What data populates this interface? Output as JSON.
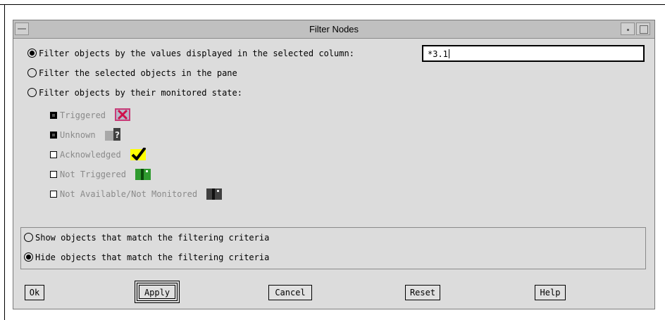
{
  "window": {
    "title": "Filter Nodes"
  },
  "filter_options": {
    "by_column_label": "Filter objects by the values displayed in the selected column:",
    "by_column_value": "*3.1",
    "selected_objects_label": "Filter the selected objects in the pane",
    "monitored_state_label": "Filter objects by their monitored state:",
    "selected": "by_column"
  },
  "states": [
    {
      "label": "Triggered",
      "checked": true,
      "icon": "triggered-x-icon",
      "color": "#c83c78"
    },
    {
      "label": "Unknown",
      "checked": true,
      "icon": "unknown-question-icon",
      "color": "#a0a0a0"
    },
    {
      "label": "Acknowledged",
      "checked": false,
      "icon": "acknowledged-check-icon",
      "color": "#ffff00"
    },
    {
      "label": "Not Triggered",
      "checked": false,
      "icon": "not-triggered-icon",
      "color": "#2e9a2e"
    },
    {
      "label": "Not Available/Not Monitored",
      "checked": false,
      "icon": "not-available-icon",
      "color": "#404040"
    }
  ],
  "match_options": {
    "show_label": "Show objects that match the filtering criteria",
    "hide_label": "Hide objects that match the filtering criteria",
    "selected": "hide"
  },
  "buttons": {
    "ok": "Ok",
    "apply": "Apply",
    "cancel": "Cancel",
    "reset": "Reset",
    "help": "Help"
  }
}
